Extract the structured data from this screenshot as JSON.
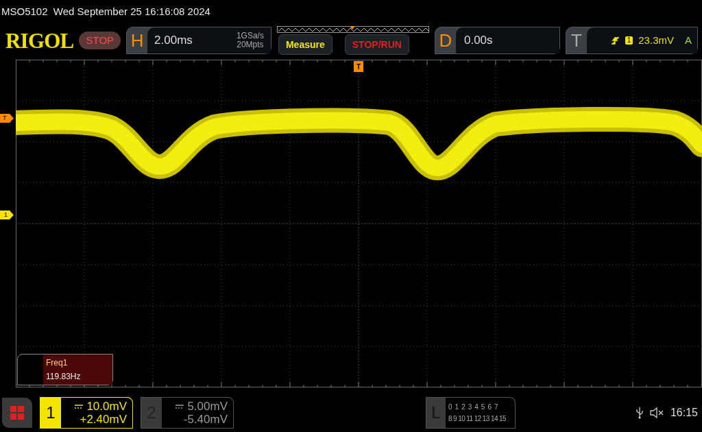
{
  "title_bar": {
    "text": "MSO5102  Wed September 25 16:16:08 2024"
  },
  "header": {
    "logo": "RIGOL",
    "run_state": "STOP",
    "horizontal": {
      "label": "H",
      "timebase": "2.00ms",
      "sample_rate": "1GSa/s",
      "memory_depth": "20Mpts"
    },
    "buttons": [
      {
        "label": "Measure",
        "kind": "measure"
      },
      {
        "label": "STOP/RUN",
        "kind": "stoprun"
      }
    ],
    "delay": {
      "label": "D",
      "value": "0.00s"
    },
    "trigger": {
      "label": "T",
      "source": "1",
      "threshold": "23.3mV",
      "mode": "A"
    }
  },
  "markers": {
    "trigger_position": "T",
    "trigger_threshold": "T",
    "channel_1": "1"
  },
  "measurement": {
    "name": "Freq1",
    "value": "119.83Hz"
  },
  "channels": [
    {
      "number": "1",
      "scale": "10.0mV",
      "offset": "+2.40mV",
      "selected": true
    },
    {
      "number": "2",
      "scale": "5.00mV",
      "offset": "-5.40mV",
      "selected": false
    }
  ],
  "logic": {
    "label": "L",
    "row_1": [
      "0",
      "1",
      "2",
      "3",
      "4",
      "5",
      "6",
      "7"
    ],
    "row_2": [
      "8",
      "9",
      "10",
      "11",
      "12",
      "13",
      "14",
      "15"
    ]
  },
  "status": {
    "time": "16:15"
  }
}
